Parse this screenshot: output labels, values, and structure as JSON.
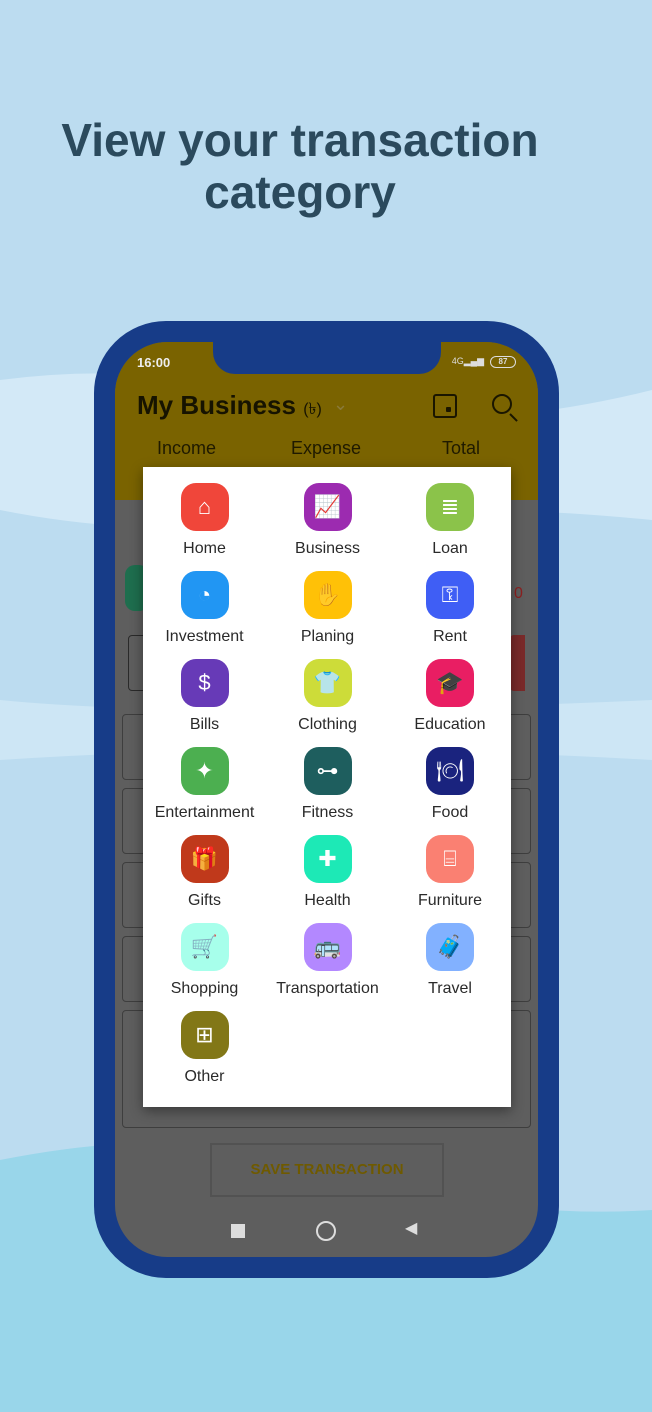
{
  "headline": {
    "line1": "View your transaction",
    "line2": "category"
  },
  "status": {
    "time": "16:00",
    "network": "4G",
    "battery": "87"
  },
  "header": {
    "title": "My Business",
    "currency": "(৳)",
    "tabs": [
      "Income",
      "Expense",
      "Total"
    ]
  },
  "background": {
    "amount_fragment": "0",
    "save_label": "SAVE TRANSACTION"
  },
  "categories": [
    {
      "label": "Home",
      "icon": "home-finance-icon",
      "color": "#f0463a"
    },
    {
      "label": "Business",
      "icon": "business-chart-icon",
      "color": "#9c2bb0"
    },
    {
      "label": "Loan",
      "icon": "coin-stack-icon",
      "color": "#8bc34a"
    },
    {
      "label": "Investment",
      "icon": "investment-icon",
      "color": "#2196f3"
    },
    {
      "label": "Planing",
      "icon": "planning-coins-icon",
      "color": "#ffc107"
    },
    {
      "label": "Rent",
      "icon": "rent-hand-key-icon",
      "color": "#3f5ef5"
    },
    {
      "label": "Bills",
      "icon": "bills-dollar-icon",
      "color": "#673ab7"
    },
    {
      "label": "Clothing",
      "icon": "tshirt-icon",
      "color": "#cddc39"
    },
    {
      "label": "Education",
      "icon": "graduation-cap-icon",
      "color": "#e91e63"
    },
    {
      "label": "Entertainment",
      "icon": "entertainment-icon",
      "color": "#4caf50"
    },
    {
      "label": "Fitness",
      "icon": "dumbbell-icon",
      "color": "#1e5e5e"
    },
    {
      "label": "Food",
      "icon": "plate-cutlery-icon",
      "color": "#1a237e"
    },
    {
      "label": "Gifts",
      "icon": "gift-icon",
      "color": "#c0391b"
    },
    {
      "label": "Health",
      "icon": "health-icon",
      "color": "#1de9b6"
    },
    {
      "label": "Furniture",
      "icon": "furniture-icon",
      "color": "#fa8072"
    },
    {
      "label": "Shopping",
      "icon": "shopping-cart-icon",
      "color": "#a7ffeb"
    },
    {
      "label": "Transportation",
      "icon": "bus-icon",
      "color": "#b388ff"
    },
    {
      "label": "Travel",
      "icon": "luggage-icon",
      "color": "#82b1ff"
    },
    {
      "label": "Other",
      "icon": "grid-shapes-icon",
      "color": "#827717"
    }
  ]
}
